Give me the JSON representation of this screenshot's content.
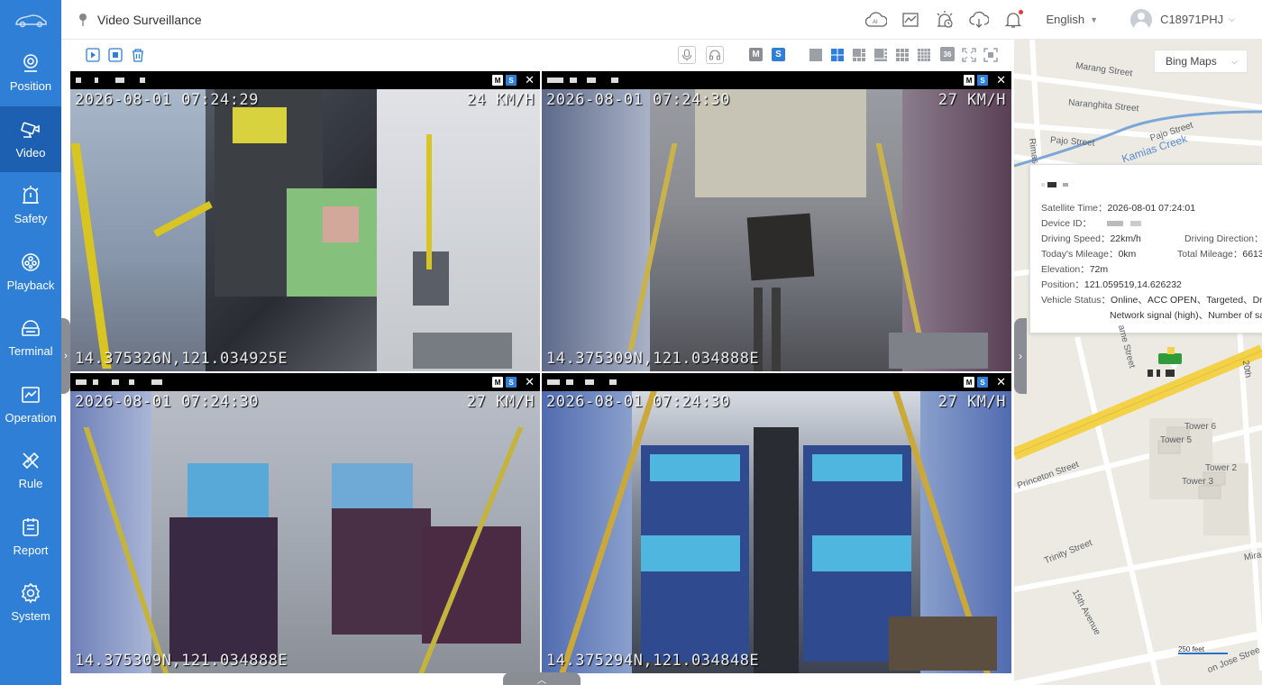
{
  "header": {
    "title": "Video Surveillance",
    "language": "English",
    "username": "C18971PHJ"
  },
  "sidebar": {
    "items": [
      {
        "label": "Position",
        "icon": "position-icon"
      },
      {
        "label": "Video",
        "icon": "video-icon",
        "active": true
      },
      {
        "label": "Safety",
        "icon": "safety-icon"
      },
      {
        "label": "Playback",
        "icon": "playback-icon"
      },
      {
        "label": "Terminal",
        "icon": "terminal-icon"
      },
      {
        "label": "Operation",
        "icon": "operation-icon"
      },
      {
        "label": "Rule",
        "icon": "rule-icon"
      },
      {
        "label": "Report",
        "icon": "report-icon"
      },
      {
        "label": "System",
        "icon": "system-icon"
      }
    ]
  },
  "toolbar": {
    "m_label": "M",
    "s_label": "S",
    "layout_36_label": "36"
  },
  "channels": [
    {
      "timestamp": "2026-08-01 07:24:29",
      "speed": "24 KM/H",
      "position": "14.375326N,121.034925E",
      "m": "M",
      "s": "S"
    },
    {
      "timestamp": "2026-08-01 07:24:30",
      "speed": "27 KM/H",
      "position": "14.375309N,121.034888E",
      "m": "M",
      "s": "S"
    },
    {
      "timestamp": "2026-08-01 07:24:30",
      "speed": "27 KM/H",
      "position": "14.375309N,121.034888E",
      "m": "M",
      "s": "S"
    },
    {
      "timestamp": "2026-08-01 07:24:30",
      "speed": "27 KM/H",
      "position": "14.375294N,121.034848E",
      "m": "M",
      "s": "S"
    }
  ],
  "map": {
    "map_type": "Bing Maps",
    "streets": [
      "Marang Street",
      "Naranghita Street",
      "Pajo Street",
      "Pajo Street",
      "Kamias Creek",
      "Rimas",
      "ame Street",
      "20th",
      "Tower 6",
      "Tower 5",
      "Tower 2",
      "Tower 3",
      "Princeton Street",
      "Trinity Street",
      "15th Avenue",
      "Mira",
      "on Jose Stree"
    ],
    "scale_label": "250 feet",
    "info": {
      "satellite_time_label": "Satellite Time：",
      "satellite_time": "2026-08-01 07:24:01",
      "device_id_label": "Device ID：",
      "driving_speed_label": "Driving Speed：",
      "driving_speed": "22km/h",
      "driving_direction_label": "Driving Direction：",
      "todays_mileage_label": "Today's Mileage：",
      "todays_mileage": "0km",
      "total_mileage_label": "Total Mileage：",
      "total_mileage": "6613",
      "elevation_label": "Elevation：",
      "elevation": "72m",
      "position_label": "Position：",
      "position": "121.059519,14.626232",
      "vehicle_status_label": "Vehicle Status：",
      "vehicle_status_line1": "Online、ACC OPEN、Targeted、Driv",
      "vehicle_status_line2": "Network signal (high)、Number of sa"
    }
  },
  "colors": {
    "sidebar": "#2f7fd6",
    "sidebar_active": "#1d5fb0",
    "accent": "#2f7fd6",
    "map_road_major": "#f3d24a"
  }
}
